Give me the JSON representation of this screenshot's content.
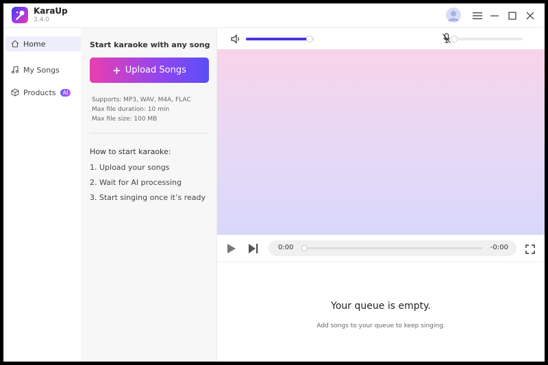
{
  "app": {
    "name": "KaraUp",
    "version": "3.4.0"
  },
  "sidebar": {
    "items": [
      {
        "label": "Home",
        "icon": "home-icon",
        "active": true
      },
      {
        "label": "My Songs",
        "icon": "music-note-icon",
        "active": false
      },
      {
        "label": "Products",
        "icon": "cube-icon",
        "active": false,
        "badge": "AI"
      }
    ]
  },
  "upload": {
    "title": "Start karaoke with any song",
    "button_label": "Upload Songs",
    "supports": "Supports: MP3, WAV, M4A, FLAC",
    "max_duration": "Max file duration: 10 min",
    "max_size": "Max file size: 100 MB"
  },
  "howto": {
    "title": "How to start karaoke:",
    "steps": [
      "1. Upload your songs",
      "2. Wait for AI processing",
      "3. Start singing once it’s ready"
    ]
  },
  "player": {
    "volume_fraction": 0.93,
    "mic_fraction": 0.0,
    "time_current": "0:00",
    "time_remaining": "-0:00",
    "progress_fraction": 0.0
  },
  "queue": {
    "title": "Your queue is empty.",
    "subtitle": "Add songs to your queue to keep singing."
  },
  "colors": {
    "accent": "#4a35e0",
    "button_start": "#e93fb0",
    "button_end": "#5a4ef5"
  }
}
